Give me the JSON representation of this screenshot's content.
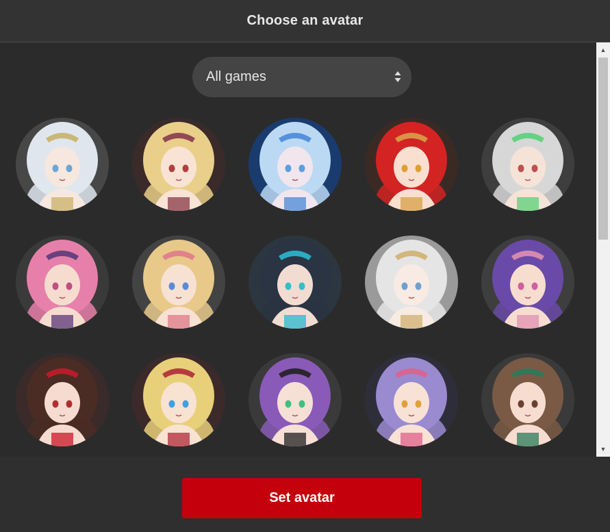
{
  "dialog": {
    "title": "Choose an avatar",
    "filter": {
      "selected": "All games"
    },
    "set_button_label": "Set avatar"
  },
  "avatars": [
    {
      "name": "avatar-white-hair-crown",
      "hair": "#dfe6ee",
      "bg": "#474747",
      "skin": "#f6e7df",
      "accent": "#c9b26a",
      "eyes": "#6aa6d6"
    },
    {
      "name": "avatar-blonde-rose-crown",
      "hair": "#e9cf8a",
      "bg": "#3a2a2a",
      "skin": "#f8e3d4",
      "accent": "#8a3a4a",
      "eyes": "#b04040"
    },
    {
      "name": "avatar-ice-blue-hair",
      "hair": "#bcd9f3",
      "bg": "#1a3b6e",
      "skin": "#f1e6ee",
      "accent": "#4a88d8",
      "eyes": "#5a9fe0"
    },
    {
      "name": "avatar-red-hair-horns",
      "hair": "#d42323",
      "bg": "#3b2a24",
      "skin": "#f8dfd0",
      "accent": "#d8a04a",
      "eyes": "#e0a030"
    },
    {
      "name": "avatar-silver-hair-horn",
      "hair": "#d7d7d7",
      "bg": "#3e3e3e",
      "skin": "#f6e3d8",
      "accent": "#5ad07a",
      "eyes": "#c05050"
    },
    {
      "name": "avatar-pink-twintails",
      "hair": "#e680aa",
      "bg": "#3a3a3a",
      "skin": "#f6dccf",
      "accent": "#5a3a7a",
      "eyes": "#c05080"
    },
    {
      "name": "avatar-blonde-flower",
      "hair": "#e8c98a",
      "bg": "#434343",
      "skin": "#f7e1d3",
      "accent": "#e07a8a",
      "eyes": "#5a8ad8"
    },
    {
      "name": "avatar-dark-hair-teal",
      "hair": "#2a3442",
      "bg": "#2c3640",
      "skin": "#f2dcd2",
      "accent": "#2ab8d0",
      "eyes": "#30c0c8"
    },
    {
      "name": "avatar-silver-veil",
      "hair": "#e5e5e5",
      "bg": "#9a9a9a",
      "skin": "#f8ebe3",
      "accent": "#d0b070",
      "eyes": "#70a0d0"
    },
    {
      "name": "avatar-purple-hair-maid",
      "hair": "#6a4aa8",
      "bg": "#3e3e3e",
      "skin": "#f6ddd0",
      "accent": "#e090b0",
      "eyes": "#d060a0"
    },
    {
      "name": "avatar-brunette-red-bow",
      "hair": "#4a2c24",
      "bg": "#3a2a2a",
      "skin": "#f6dcd0",
      "accent": "#c81a2a",
      "eyes": "#b03030"
    },
    {
      "name": "avatar-blonde-blue-eyes",
      "hair": "#e8cf7a",
      "bg": "#3c2a2a",
      "skin": "#f8e2d2",
      "accent": "#b02a3a",
      "eyes": "#40a0e0"
    },
    {
      "name": "avatar-violet-long-hair",
      "hair": "#8a5ab8",
      "bg": "#3a3a3a",
      "skin": "#f6e0d6",
      "accent": "#202020",
      "eyes": "#40c080"
    },
    {
      "name": "avatar-lavender-bunny",
      "hair": "#9a8ad0",
      "bg": "#2e2e3a",
      "skin": "#f8e2d6",
      "accent": "#e0608a",
      "eyes": "#e0a040"
    },
    {
      "name": "avatar-brown-hair-cap",
      "hair": "#7a5a44",
      "bg": "#3a3a3a",
      "skin": "#f6ddd0",
      "accent": "#2a7a5a",
      "eyes": "#6a4030"
    }
  ]
}
